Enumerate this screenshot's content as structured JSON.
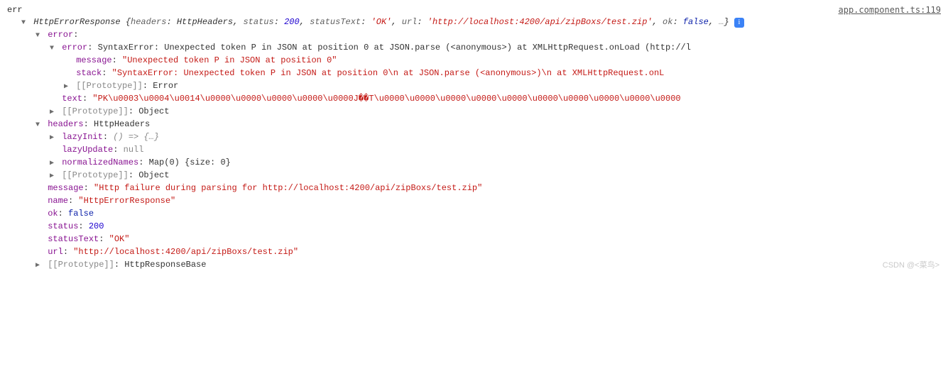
{
  "source_link": "app.component.ts:119",
  "top_label": "err",
  "header": {
    "type": "HttpErrorResponse",
    "headers_label": "headers",
    "headers_value": "HttpHeaders",
    "status_label": "status",
    "status_value": "200",
    "statusText_label": "statusText",
    "statusText_value": "'OK'",
    "url_label": "url",
    "url_value": "'http://localhost:4200/api/zipBoxs/test.zip'",
    "ok_label": "ok",
    "ok_value": "false",
    "ellipsis": "…"
  },
  "error": {
    "label": "error",
    "inner_error_label": "error",
    "inner_error_value": "SyntaxError: Unexpected token P in JSON at position 0 at JSON.parse (<anonymous>) at XMLHttpRequest.onLoad (http://l",
    "message_label": "message",
    "message_value": "\"Unexpected token P in JSON at position 0\"",
    "stack_label": "stack",
    "stack_value": "\"SyntaxError: Unexpected token P in JSON at position 0\\n    at JSON.parse (<anonymous>)\\n    at XMLHttpRequest.onL",
    "proto1_label": "[[Prototype]]",
    "proto1_value": "Error",
    "text_label": "text",
    "text_value": "\"PK\\u0003\\u0004\\u0014\\u0000\\u0000\\u0000\\u0000\\u0000J��T\\u0000\\u0000\\u0000\\u0000\\u0000\\u0000\\u0000\\u0000\\u0000\\u0000",
    "proto2_label": "[[Prototype]]",
    "proto2_value": "Object"
  },
  "headers": {
    "label": "headers",
    "type": "HttpHeaders",
    "lazyInit_label": "lazyInit",
    "lazyInit_value": "() => {…}",
    "lazyUpdate_label": "lazyUpdate",
    "lazyUpdate_value": "null",
    "normalizedNames_label": "normalizedNames",
    "normalizedNames_value": "Map(0) {size: 0}",
    "proto_label": "[[Prototype]]",
    "proto_value": "Object"
  },
  "props": {
    "message_label": "message",
    "message_value": "\"Http failure during parsing for http://localhost:4200/api/zipBoxs/test.zip\"",
    "name_label": "name",
    "name_value": "\"HttpErrorResponse\"",
    "ok_label": "ok",
    "ok_value": "false",
    "status_label": "status",
    "status_value": "200",
    "statusText_label": "statusText",
    "statusText_value": "\"OK\"",
    "url_label": "url",
    "url_value": "\"http://localhost:4200/api/zipBoxs/test.zip\""
  },
  "footer": {
    "proto_label": "[[Prototype]]",
    "proto_value": "HttpResponseBase"
  },
  "watermark": "CSDN @<菜鸟>"
}
